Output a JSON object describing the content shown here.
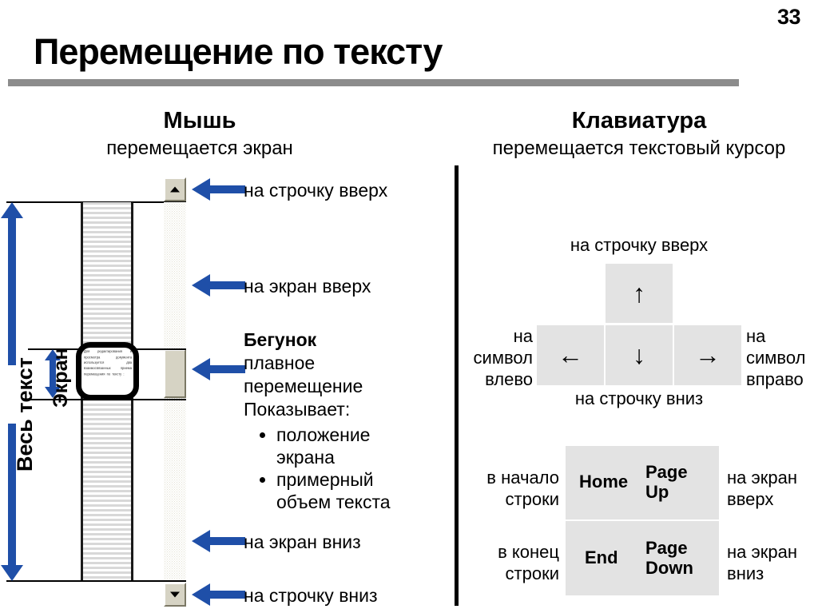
{
  "slide": {
    "page_number": "33",
    "title": "Перемещение по тексту",
    "accent_blue": "#1f4fa8",
    "rule_gray": "#8c8c8c",
    "key_gray": "#e3e3e3"
  },
  "mouse": {
    "heading": "Мышь",
    "subheading": "перемещается экран",
    "axis_whole_text": "Весь текст",
    "axis_screen": "Экран",
    "magnifier_text": "Для редактирования и просмотра документа используется два взаимосвязанных приема перемещения по тексту :",
    "callouts": {
      "line_up": "на строчку вверх",
      "screen_up": "на экран вверх",
      "thumb_title": "Бегунок",
      "thumb_line1": "плавное",
      "thumb_line2": "перемещение",
      "thumb_line3": "Показывает:",
      "thumb_bullets": [
        "положение экрана",
        "примерный объем текста"
      ],
      "screen_down": "на экран вниз",
      "line_down": "на строчку вниз"
    },
    "scrollbar": {
      "button_up_icon": "triangle-up-icon",
      "button_down_icon": "triangle-down-icon",
      "thumb_name": "scrollbar-thumb"
    }
  },
  "keyboard": {
    "heading": "Клавиатура",
    "subheading": "перемещается текстовый курсор",
    "arrow_cluster": {
      "caption_above": "на строчку вверх",
      "caption_below": "на строчку вниз",
      "caption_left": "на символ влево",
      "caption_right": "на символ вправо",
      "key_up": "↑",
      "key_left": "←",
      "key_down": "↓",
      "key_right": "→"
    },
    "nav_keys": [
      {
        "left_caption": "в начало строки",
        "key_a": "Home",
        "key_b": "Page Up",
        "right_caption": "на экран вверх"
      },
      {
        "left_caption": "в конец строки",
        "key_a": "End",
        "key_b": "Page Down",
        "right_caption": "на экран вниз"
      }
    ]
  }
}
